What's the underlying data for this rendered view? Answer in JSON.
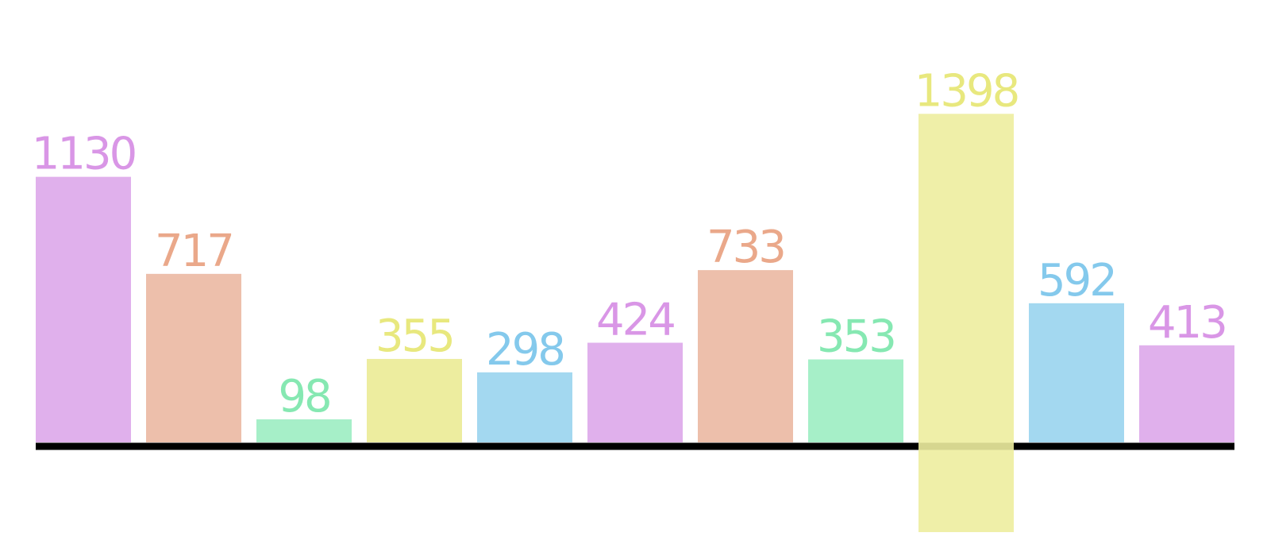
{
  "chart_data": {
    "type": "bar",
    "title": "",
    "xlabel": "",
    "ylabel": "",
    "categories": [],
    "values": [
      1130,
      717,
      98,
      355,
      298,
      424,
      733,
      353,
      1398,
      592,
      413
    ],
    "colors": [
      "#e0b0ec",
      "#edbfab",
      "#a6efc8",
      "#eded9f",
      "#a3d8f0",
      "#e0b0ec",
      "#edbfab",
      "#a6efc8",
      "#eded9f",
      "#a3d8f0",
      "#e0b0ec"
    ],
    "label_colors": [
      "#d996e6",
      "#eaa88a",
      "#86e8b2",
      "#e8e87e",
      "#84c9ec",
      "#d996e6",
      "#eaa88a",
      "#86e8b2",
      "#e8e87e",
      "#84c9ec",
      "#d996e6"
    ],
    "overlay_bar_index": 8,
    "axis_color": "#000000",
    "grid": false,
    "legend": "none"
  }
}
